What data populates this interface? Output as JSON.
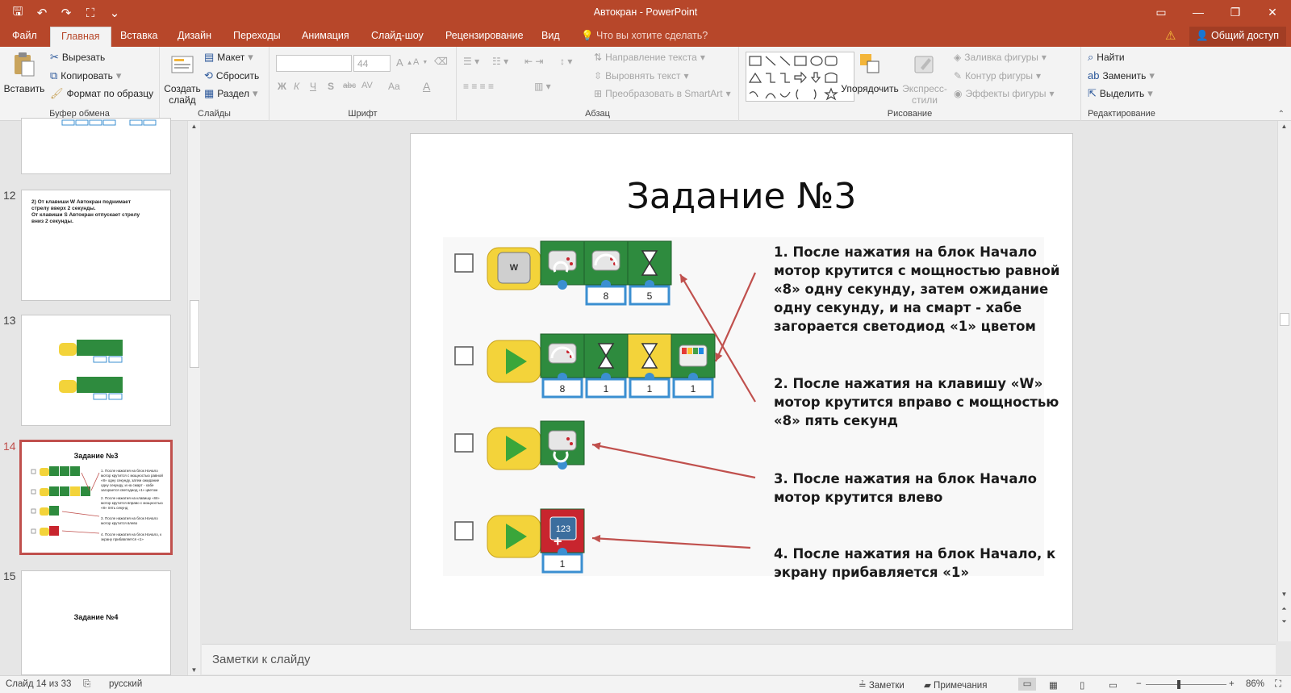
{
  "window": {
    "title": "Автокран - PowerPoint"
  },
  "tabs": {
    "file": "Файл",
    "home": "Главная",
    "insert": "Вставка",
    "design": "Дизайн",
    "transitions": "Переходы",
    "animations": "Анимация",
    "slideshow": "Слайд-шоу",
    "review": "Рецензирование",
    "view": "Вид",
    "tellme": "Что вы хотите сделать?",
    "share": "Общий доступ"
  },
  "ribbon": {
    "clipboard": {
      "paste": "Вставить",
      "cut": "Вырезать",
      "copy": "Копировать",
      "format_painter": "Формат по образцу",
      "label": "Буфер обмена"
    },
    "slides": {
      "new_slide_line1": "Создать",
      "new_slide_line2": "слайд",
      "layout": "Макет",
      "reset": "Сбросить",
      "section": "Раздел",
      "label": "Слайды"
    },
    "font": {
      "font_name": "",
      "font_size": "44",
      "bold": "Ж",
      "italic": "К",
      "underline": "Ч",
      "shadow": "S",
      "strike": "abc",
      "spacing": "AV",
      "case": "Aa",
      "color": "A",
      "grow": "A",
      "shrink": "A",
      "label": "Шрифт"
    },
    "paragraph": {
      "text_direction": "Направление текста",
      "align_text": "Выровнять текст",
      "smartart": "Преобразовать в SmartArt",
      "label": "Абзац"
    },
    "drawing": {
      "arrange": "Упорядочить",
      "quick_styles_line1": "Экспресс-",
      "quick_styles_line2": "стили",
      "shape_fill": "Заливка фигуры",
      "shape_outline": "Контур фигуры",
      "shape_effects": "Эффекты фигуры",
      "label": "Рисование"
    },
    "editing": {
      "find": "Найти",
      "replace": "Заменить",
      "select": "Выделить",
      "label": "Редактирование"
    }
  },
  "thumbnails": [
    {
      "num": "12",
      "lines": [
        "2) От клавиши W Автокран поднимает",
        "стрелу вверх 2 секунды.",
        "От клавиши S Автокран отпускает стрелу",
        "вниз 2 секунды."
      ]
    },
    {
      "num": "13"
    },
    {
      "num": "14",
      "title": "Задание №3",
      "lines": [
        "1. После нажатия на блок Начало",
        "мотор крутится с мощностью равной",
        "«8» одну секунду, затем ожидание",
        "одну секунду, и на смарт - хабе",
        "загорается светодиод «1» цветом",
        "2. После нажатия на клавишу «W»",
        "мотор крутится вправо с мощностью",
        "«8» пять секунд",
        "3. После нажатия на блок Начало",
        "мотор крутится влево",
        "4. После нажатия на блок Начало, к",
        "экрану прибавляется «1»"
      ]
    },
    {
      "num": "15",
      "title": "Задание №4"
    }
  ],
  "slide": {
    "title": "Задание №3",
    "items": [
      "1. После нажатия на блок Начало\nмотор крутится с мощностью равной\n«8» одну секунду, затем ожидание\nодну секунду, и на смарт - хабе\nзагорается светодиод «1» цветом",
      "2. После нажатия на клавишу «W»\nмотор крутится вправо с мощностью\n«8» пять секунд",
      "3. После нажатия на блок Начало\nмотор крутится влево",
      "4. После нажатия на блок Начало, к\nэкрану прибавляется «1»"
    ],
    "rows": [
      {
        "start": "key-w",
        "key": "W",
        "blocks": [
          "motor-right",
          "motor-power",
          "wait"
        ],
        "params": [
          "8",
          "5"
        ]
      },
      {
        "start": "play",
        "blocks": [
          "motor-power",
          "wait",
          "wait-yellow",
          "light"
        ],
        "params": [
          "8",
          "1",
          "1",
          "1"
        ]
      },
      {
        "start": "play",
        "blocks": [
          "motor-left"
        ],
        "params": []
      },
      {
        "start": "play",
        "blocks": [
          "display-add"
        ],
        "params": [
          "1"
        ]
      }
    ]
  },
  "notes": {
    "placeholder": "Заметки к слайду"
  },
  "status": {
    "slide": "Слайд 14 из 33",
    "language": "русский",
    "notes": "Заметки",
    "comments": "Примечания",
    "zoom": "86%"
  },
  "colors": {
    "accent": "#b7472a",
    "block_green": "#2e8b3e",
    "block_yellow": "#f3d33a",
    "param_blue": "#3b8fd1",
    "arrow_red": "#c0504d"
  }
}
